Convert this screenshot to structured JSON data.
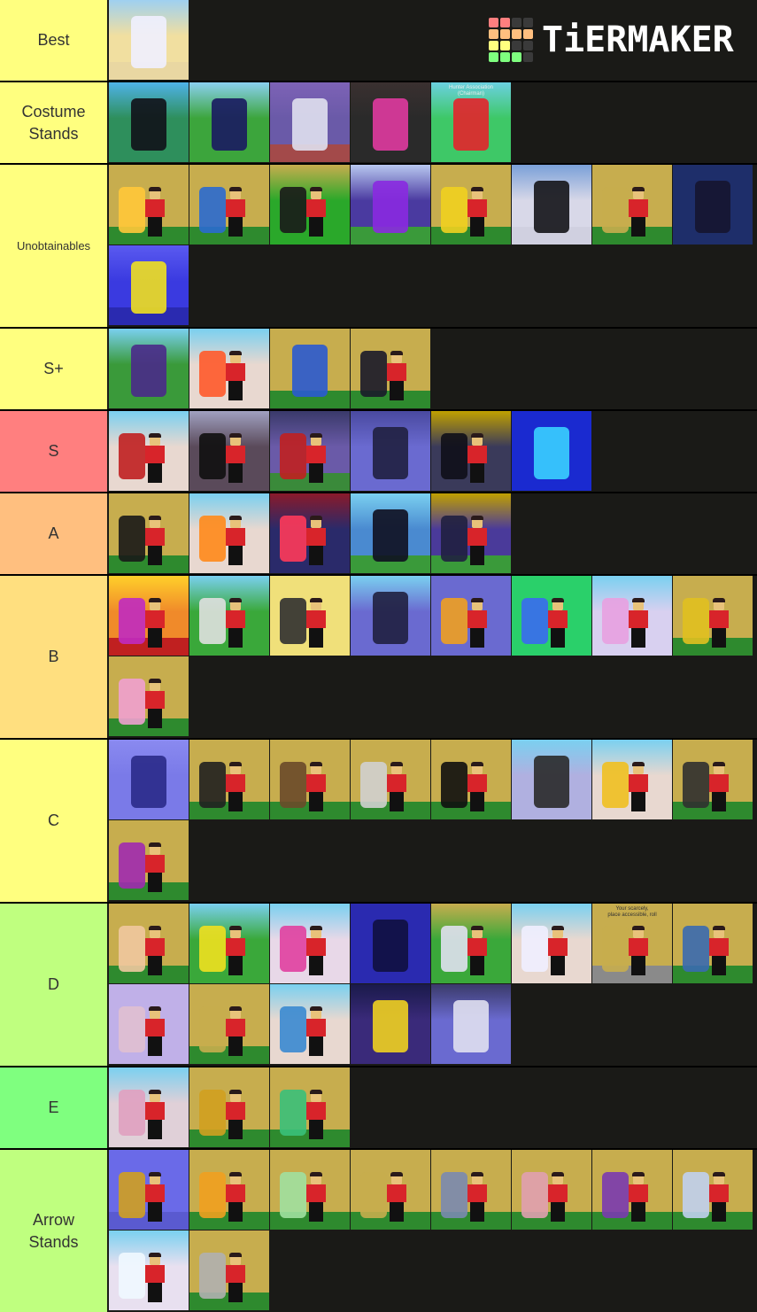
{
  "logo": {
    "text": "TiERMAKER",
    "grid_colors": [
      "#ff7f7f",
      "#ff7f7f",
      "#3a3a3a",
      "#3a3a3a",
      "#ffbf7f",
      "#ffbf7f",
      "#ffbf7f",
      "#ffbf7f",
      "#ffff7f",
      "#ffff7f",
      "#3a3a3a",
      "#3a3a3a",
      "#7fff7f",
      "#7fff7f",
      "#7fff7f",
      "#3a3a3a"
    ]
  },
  "tiers": [
    {
      "label": "Best",
      "color": "#ffff7f",
      "items": [
        {
          "bg": "#f1dfa0",
          "sky": "#9fd0f0",
          "ground": "#e9d7a2",
          "stand": "#f0f0ff",
          "figure": false
        }
      ]
    },
    {
      "label": "Costume\nStands",
      "color": "#ffff7f",
      "items": [
        {
          "bg": "#2e8f5c",
          "sky": "#4fb2e8",
          "ground": "#2e8f5c",
          "stand": "#111118",
          "figure": false
        },
        {
          "bg": "#3ca53c",
          "sky": "#8ad0f0",
          "ground": "#3ca53c",
          "stand": "#1a1a60",
          "figure": false
        },
        {
          "bg": "#6a5aa8",
          "sky": "#7d62b6",
          "ground": "#a34a4a",
          "stand": "#e0e0ee",
          "figure": false
        },
        {
          "bg": "#2a2a2a",
          "sky": "#3a3030",
          "ground": "#2a2a2a",
          "stand": "#e03aa0",
          "figure": false
        },
        {
          "bg": "#3ec867",
          "sky": "#6bd0e0",
          "ground": "#3ec867",
          "stand": "#e3242b",
          "figure": false,
          "caption": "Hunter Association\n(Chairman)"
        }
      ]
    },
    {
      "label": "Unobtainables",
      "color": "#ffff7f",
      "small": true,
      "items": [
        {
          "bg": "#c7ad4e",
          "sky": "#c7ad4e",
          "ground": "#2e8a2e",
          "stand": "#ffc83a",
          "figure": true
        },
        {
          "bg": "#c7ad4e",
          "sky": "#c7ad4e",
          "ground": "#2e8a2e",
          "stand": "#2a6ad0",
          "figure": true
        },
        {
          "bg": "#2aa82a",
          "sky": "#c7ad4e",
          "ground": "#2aa82a",
          "stand": "#1a1a1a",
          "figure": true
        },
        {
          "bg": "#4a3aa0",
          "sky": "#b8c8f0",
          "ground": "#3a9a3a",
          "stand": "#8a2ae0",
          "figure": false
        },
        {
          "bg": "#c7ad4e",
          "sky": "#c7ad4e",
          "ground": "#2e8a2e",
          "stand": "#f0d020",
          "figure": true
        },
        {
          "bg": "#d8d8e8",
          "sky": "#7aa0d8",
          "ground": "#d0d0e0",
          "stand": "#141418",
          "figure": false
        },
        {
          "bg": "#c7ad4e",
          "sky": "#c7ad4e",
          "ground": "#2e8a2e",
          "stand": "#c7ad4e",
          "figure": true
        },
        {
          "bg": "#1e2e6a",
          "sky": "#1e2e6a",
          "ground": "#1e2e6a",
          "stand": "#151530",
          "figure": false
        },
        {
          "bg": "#3a3ae0",
          "sky": "#5a5af0",
          "ground": "#2a2ab0",
          "stand": "#f0e020",
          "figure": false
        }
      ]
    },
    {
      "label": "S+",
      "color": "#ffff7f",
      "items": [
        {
          "bg": "#3a9a3a",
          "sky": "#7ad0f0",
          "ground": "#3a9a3a",
          "stand": "#4a2a8a",
          "figure": false
        },
        {
          "bg": "#e8d8d0",
          "sky": "#7ad0f0",
          "ground": "#e8d8d0",
          "stand": "#ff5a2a",
          "figure": true
        },
        {
          "bg": "#c7ad4e",
          "sky": "#c7ad4e",
          "ground": "#2e8a2e",
          "stand": "#2a5ad0",
          "figure": false
        },
        {
          "bg": "#c7ad4e",
          "sky": "#c7ad4e",
          "ground": "#2e8a2e",
          "stand": "#1a1a2a",
          "figure": true
        }
      ]
    },
    {
      "label": "S",
      "color": "#ff7f7f",
      "items": [
        {
          "bg": "#e8d8d0",
          "sky": "#7ad0f0",
          "ground": "#e8d8d0",
          "stand": "#c02020",
          "figure": true
        },
        {
          "bg": "#5a4a5a",
          "sky": "#a0a0c0",
          "ground": "#5a4a5a",
          "stand": "#101010",
          "figure": true
        },
        {
          "bg": "#6a5aa8",
          "sky": "#3a3a6a",
          "ground": "#3a8a3a",
          "stand": "#c02020",
          "figure": true
        },
        {
          "bg": "#6a6ad0",
          "sky": "#4a4aa0",
          "ground": "#6a6ad0",
          "stand": "#202040",
          "figure": false
        },
        {
          "bg": "#3a3a5a",
          "sky": "#c0a000",
          "ground": "#3a3a5a",
          "stand": "#101018",
          "figure": true
        },
        {
          "bg": "#1a2ad0",
          "sky": "#1a2ad0",
          "ground": "#1a2ad0",
          "stand": "#3ad0ff",
          "figure": false
        }
      ]
    },
    {
      "label": "A",
      "color": "#ffbf7f",
      "items": [
        {
          "bg": "#c7ad4e",
          "sky": "#c7ad4e",
          "ground": "#2e8a2e",
          "stand": "#181818",
          "figure": true
        },
        {
          "bg": "#e8d8d0",
          "sky": "#7ad0f0",
          "ground": "#e8d8d0",
          "stand": "#ff8a1a",
          "figure": true
        },
        {
          "bg": "#2a2a6a",
          "sky": "#8a1a2a",
          "ground": "#2a2a6a",
          "stand": "#ff3a5a",
          "figure": true
        },
        {
          "bg": "#4a8ad0",
          "sky": "#7ad0f0",
          "ground": "#3a9a3a",
          "stand": "#101020",
          "figure": false
        },
        {
          "bg": "#4a3a9a",
          "sky": "#c0a000",
          "ground": "#3a9a3a",
          "stand": "#202040",
          "figure": true
        }
      ]
    },
    {
      "label": "B",
      "color": "#ffdf7f",
      "items": [
        {
          "bg": "#f08a2a",
          "sky": "#ffd02a",
          "ground": "#c02020",
          "stand": "#c02ac0",
          "figure": true
        },
        {
          "bg": "#3aa83a",
          "sky": "#7ad0f0",
          "ground": "#3aa83a",
          "stand": "#e0e0e0",
          "figure": true
        },
        {
          "bg": "#f0e07a",
          "sky": "#f0e07a",
          "ground": "#f0e07a",
          "stand": "#303030",
          "figure": true
        },
        {
          "bg": "#6a6ad0",
          "sky": "#7ad0f0",
          "ground": "#6a6ad0",
          "stand": "#202040",
          "figure": false
        },
        {
          "bg": "#6a6ad0",
          "sky": "#6a6ad0",
          "ground": "#6a6ad0",
          "stand": "#f0a020",
          "figure": true
        },
        {
          "bg": "#2ad06a",
          "sky": "#2ad06a",
          "ground": "#2ad06a",
          "stand": "#3a6af0",
          "figure": true
        },
        {
          "bg": "#d8d0f0",
          "sky": "#7ad0f0",
          "ground": "#d8d0f0",
          "stand": "#e8a0e0",
          "figure": true
        },
        {
          "bg": "#c7ad4e",
          "sky": "#c7ad4e",
          "ground": "#2e8a2e",
          "stand": "#e0c020",
          "figure": true
        },
        {
          "bg": "#c7ad4e",
          "sky": "#c7ad4e",
          "ground": "#2e8a2e",
          "stand": "#f0a0d0",
          "figure": true
        }
      ]
    },
    {
      "label": "C",
      "color": "#ffff7f",
      "items": [
        {
          "bg": "#7a7ae8",
          "sky": "#8a8af0",
          "ground": "#7a7ae8",
          "stand": "#2a2a8a",
          "figure": false
        },
        {
          "bg": "#c7ad4e",
          "sky": "#c7ad4e",
          "ground": "#2e8a2e",
          "stand": "#202020",
          "figure": true
        },
        {
          "bg": "#c7ad4e",
          "sky": "#c7ad4e",
          "ground": "#2e8a2e",
          "stand": "#6a4a2a",
          "figure": true
        },
        {
          "bg": "#c7ad4e",
          "sky": "#c7ad4e",
          "ground": "#2e8a2e",
          "stand": "#d0d0d0",
          "figure": true
        },
        {
          "bg": "#c7ad4e",
          "sky": "#c7ad4e",
          "ground": "#2e8a2e",
          "stand": "#101010",
          "figure": true
        },
        {
          "bg": "#b0b0e0",
          "sky": "#7ad0f0",
          "ground": "#b0b0e0",
          "stand": "#2a2a2a",
          "figure": false
        },
        {
          "bg": "#e8d8d0",
          "sky": "#7ad0f0",
          "ground": "#e8d8d0",
          "stand": "#f0c020",
          "figure": true
        },
        {
          "bg": "#c7ad4e",
          "sky": "#c7ad4e",
          "ground": "#2e8a2e",
          "stand": "#303030",
          "figure": true
        },
        {
          "bg": "#c7ad4e",
          "sky": "#c7ad4e",
          "ground": "#2e8a2e",
          "stand": "#a02ab0",
          "figure": true
        }
      ]
    },
    {
      "label": "D",
      "color": "#bfff7f",
      "items": [
        {
          "bg": "#c7ad4e",
          "sky": "#c7ad4e",
          "ground": "#2e8a2e",
          "stand": "#f0c8a0",
          "figure": true
        },
        {
          "bg": "#3aa83a",
          "sky": "#7ad0f0",
          "ground": "#3aa83a",
          "stand": "#f0e020",
          "figure": true
        },
        {
          "bg": "#e8d8e8",
          "sky": "#7ad0f0",
          "ground": "#e8d8e8",
          "stand": "#e040a0",
          "figure": true
        },
        {
          "bg": "#2a2ab0",
          "sky": "#2a2ab0",
          "ground": "#2a2ab0",
          "stand": "#101040",
          "figure": false
        },
        {
          "bg": "#3aa83a",
          "sky": "#c7ad4e",
          "ground": "#3aa83a",
          "stand": "#e0e0f0",
          "figure": true
        },
        {
          "bg": "#e8d8d0",
          "sky": "#7ad0f0",
          "ground": "#e8d8d0",
          "stand": "#f0f0ff",
          "figure": true
        },
        {
          "bg": "#c7ad4e",
          "sky": "#c7ad4e",
          "ground": "#8a8a8a",
          "stand": "#c7ad4e",
          "figure": true,
          "caption": "Your scarcely,\nplace accessible, roll"
        },
        {
          "bg": "#c7ad4e",
          "sky": "#c7ad4e",
          "ground": "#2e8a2e",
          "stand": "#3a6ab0",
          "figure": true
        },
        {
          "bg": "#c0b0e8",
          "sky": "#c0b0e8",
          "ground": "#c0b0e8",
          "stand": "#e0c0d0",
          "figure": true
        },
        {
          "bg": "#c7ad4e",
          "sky": "#c7ad4e",
          "ground": "#2e8a2e",
          "stand": "#c7ad4e",
          "figure": true
        },
        {
          "bg": "#e8d8d0",
          "sky": "#7ad0f0",
          "ground": "#e8d8d0",
          "stand": "#3a8ad0",
          "figure": true
        },
        {
          "bg": "#3a2a7a",
          "sky": "#1a1a4a",
          "ground": "#3a2a7a",
          "stand": "#f0d020",
          "figure": false
        },
        {
          "bg": "#6a6ad0",
          "sky": "#3a3a6a",
          "ground": "#6a6ad0",
          "stand": "#e0e0f0",
          "figure": false
        }
      ]
    },
    {
      "label": "E",
      "color": "#7fff7f",
      "items": [
        {
          "bg": "#e0d0d8",
          "sky": "#7ad0f0",
          "ground": "#e0d0d8",
          "stand": "#e0a0c0",
          "figure": true
        },
        {
          "bg": "#c7ad4e",
          "sky": "#c7ad4e",
          "ground": "#2e8a2e",
          "stand": "#d0a020",
          "figure": true
        },
        {
          "bg": "#c7ad4e",
          "sky": "#c7ad4e",
          "ground": "#2e8a2e",
          "stand": "#3ac07a",
          "figure": true
        }
      ]
    },
    {
      "label": "Arrow\nStands",
      "color": "#bfff7f",
      "items": [
        {
          "bg": "#6a6ae8",
          "sky": "#6a6ae8",
          "ground": "#5a5ad0",
          "stand": "#d0a020",
          "figure": true
        },
        {
          "bg": "#c7ad4e",
          "sky": "#c7ad4e",
          "ground": "#2e8a2e",
          "stand": "#f0a020",
          "figure": true
        },
        {
          "bg": "#c7ad4e",
          "sky": "#c7ad4e",
          "ground": "#2e8a2e",
          "stand": "#a0e0a0",
          "figure": true
        },
        {
          "bg": "#c7ad4e",
          "sky": "#c7ad4e",
          "ground": "#2e8a2e",
          "stand": "#c7ad4e",
          "figure": true
        },
        {
          "bg": "#c7ad4e",
          "sky": "#c7ad4e",
          "ground": "#2e8a2e",
          "stand": "#7a8ab0",
          "figure": true
        },
        {
          "bg": "#c7ad4e",
          "sky": "#c7ad4e",
          "ground": "#2e8a2e",
          "stand": "#e0a0b0",
          "figure": true
        },
        {
          "bg": "#c7ad4e",
          "sky": "#c7ad4e",
          "ground": "#2e8a2e",
          "stand": "#7a3ab0",
          "figure": true
        },
        {
          "bg": "#c7ad4e",
          "sky": "#c7ad4e",
          "ground": "#2e8a2e",
          "stand": "#c0d0f0",
          "figure": true
        },
        {
          "bg": "#e8e0f0",
          "sky": "#7ad0f0",
          "ground": "#e8e0f0",
          "stand": "#f0f8ff",
          "figure": true
        },
        {
          "bg": "#c7ad4e",
          "sky": "#c7ad4e",
          "ground": "#2e8a2e",
          "stand": "#b0b0b0",
          "figure": true
        }
      ]
    }
  ]
}
